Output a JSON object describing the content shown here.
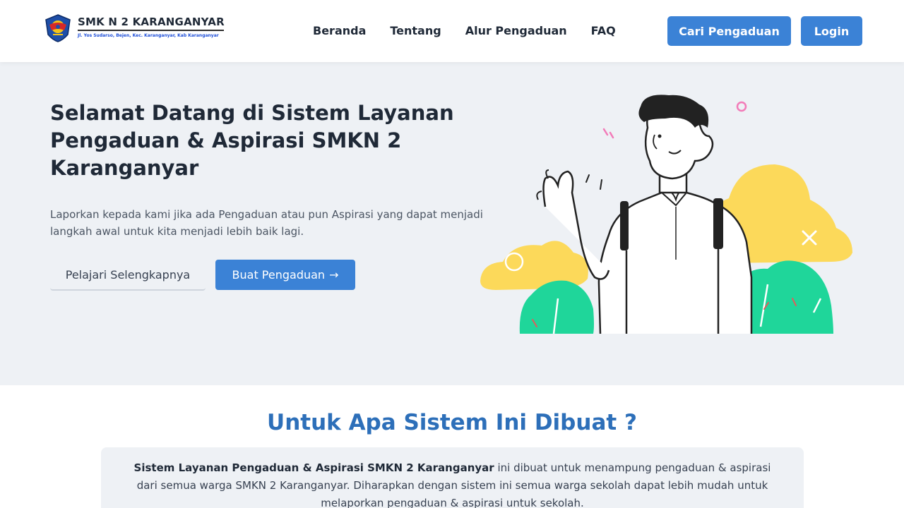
{
  "brand": {
    "name": "SMK N 2 KARANGANYAR",
    "address": "Jl. Yos Sudarso, Bejen, Kec. Karanganyar, Kab Karanganyar"
  },
  "nav": {
    "links": [
      "Beranda",
      "Tentang",
      "Alur Pengaduan",
      "FAQ"
    ],
    "search_button": "Cari Pengaduan",
    "login_button": "Login"
  },
  "hero": {
    "title": "Selamat Datang di Sistem Layanan Pengaduan & Aspirasi SMKN 2 Karanganyar",
    "description": "Laporkan kepada kami jika ada Pengaduan atau pun Aspirasi yang dapat menjadi langkah awal untuk kita menjadi lebih baik lagi.",
    "learn_button": "Pelajari Selengkapnya",
    "report_button": "Buat Pengaduan",
    "report_icon": "arrow-right-icon"
  },
  "purpose": {
    "title": "Untuk Apa Sistem Ini Dibuat ?",
    "text_bold": "Sistem Layanan Pengaduan & Aspirasi SMKN 2 Karanganyar",
    "text_rest": " ini dibuat untuk menampung pengaduan & aspirasi dari semua warga SMKN 2 Karanganyar. Diharapkan dengan sistem ini semua warga sekolah dapat lebih mudah untuk melaporkan pengaduan & aspirasi untuk sekolah."
  },
  "colors": {
    "primary": "#3b82d6",
    "heading_blue": "#2d6fb9",
    "hero_bg": "#eef1f5",
    "illustration_yellow": "#fcd95a",
    "illustration_green": "#1fd69a"
  }
}
